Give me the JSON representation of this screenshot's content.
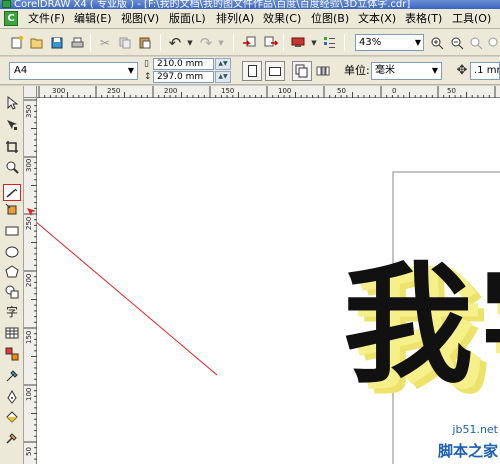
{
  "window": {
    "title": "CorelDRAW X4 ( 专业版 ) - [F:\\我的文档\\我的图文件作品\\百度\\百度经验\\3D立体字.cdr]"
  },
  "menu": {
    "items": [
      {
        "label": "文件(F)"
      },
      {
        "label": "编辑(E)"
      },
      {
        "label": "视图(V)"
      },
      {
        "label": "版面(L)"
      },
      {
        "label": "排列(A)"
      },
      {
        "label": "效果(C)"
      },
      {
        "label": "位图(B)"
      },
      {
        "label": "文本(X)"
      },
      {
        "label": "表格(T)"
      },
      {
        "label": "工具(O)"
      }
    ]
  },
  "standard_toolbar": {
    "zoom_level": "43%"
  },
  "property_bar": {
    "paper_size": "A4",
    "width": "210.0 mm",
    "height": "297.0 mm",
    "unit_label": "单位:",
    "unit_value": "毫米",
    "nudge": ".1 mm"
  },
  "rulers": {
    "top_labels": [
      "300",
      "250",
      "200",
      "150",
      "100",
      "50",
      "0",
      "50"
    ],
    "left_labels": [
      "350",
      "300",
      "250",
      "200",
      "150",
      "100",
      "50"
    ]
  },
  "canvas": {
    "artwork_text": "我",
    "artwork_text_2": "字",
    "annotation_color": "#e02020",
    "extrude_color": "#f5f08a"
  },
  "watermark": {
    "url": "jb51.net",
    "text": "脚本之家"
  }
}
